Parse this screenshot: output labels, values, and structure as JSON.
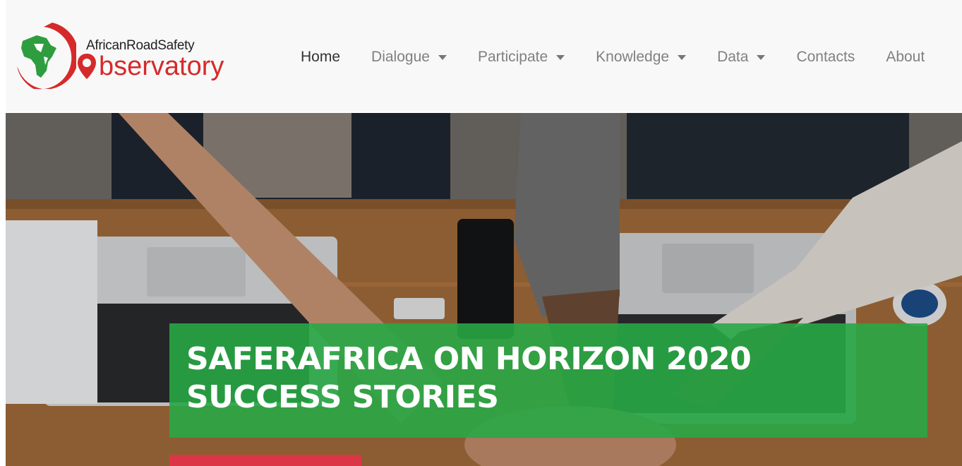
{
  "logo": {
    "line1": "AfricanRoadSafety",
    "line2": "bservatory",
    "brand_red": "#d62a2a",
    "brand_green": "#2e9d3f"
  },
  "nav": {
    "items": [
      {
        "label": "Home",
        "active": true,
        "dropdown": false
      },
      {
        "label": "Dialogue",
        "dropdown": true
      },
      {
        "label": "Participate",
        "dropdown": true
      },
      {
        "label": "Knowledge",
        "dropdown": true
      },
      {
        "label": "Data",
        "dropdown": true
      },
      {
        "label": "Contacts",
        "dropdown": false
      },
      {
        "label": "About",
        "dropdown": false
      }
    ]
  },
  "hero": {
    "title": "SAFERAFRICA ON HORIZON 2020 SUCCESS STORIES",
    "banner_color": "#28a745",
    "button_color": "#dc3545"
  }
}
